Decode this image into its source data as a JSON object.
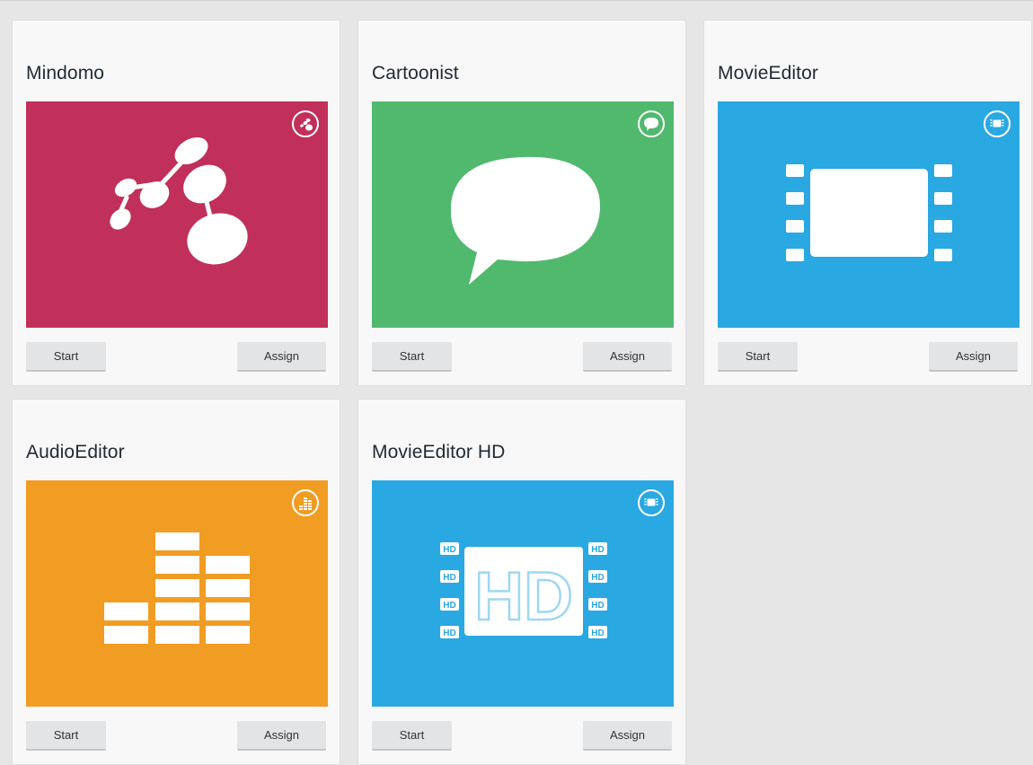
{
  "apps": [
    {
      "name": "Mindomo",
      "tile_color": "#c0305a",
      "badge_icon": "mind-map-icon",
      "art_icon": "mind-map-icon",
      "start_label": "Start",
      "assign_label": "Assign"
    },
    {
      "name": "Cartoonist",
      "tile_color": "#50b96e",
      "badge_icon": "speech-bubble-icon",
      "art_icon": "speech-bubble-icon",
      "start_label": "Start",
      "assign_label": "Assign"
    },
    {
      "name": "MovieEditor",
      "tile_color": "#2aa8e1",
      "badge_icon": "film-icon",
      "art_icon": "film-icon",
      "start_label": "Start",
      "assign_label": "Assign"
    },
    {
      "name": "AudioEditor",
      "tile_color": "#f19c22",
      "badge_icon": "equalizer-icon",
      "art_icon": "equalizer-icon",
      "start_label": "Start",
      "assign_label": "Assign"
    },
    {
      "name": "MovieEditor HD",
      "tile_color": "#2aa8e1",
      "badge_icon": "film-icon",
      "art_icon": "hd-film-icon",
      "art_text": "HD",
      "start_label": "Start",
      "assign_label": "Assign"
    }
  ]
}
